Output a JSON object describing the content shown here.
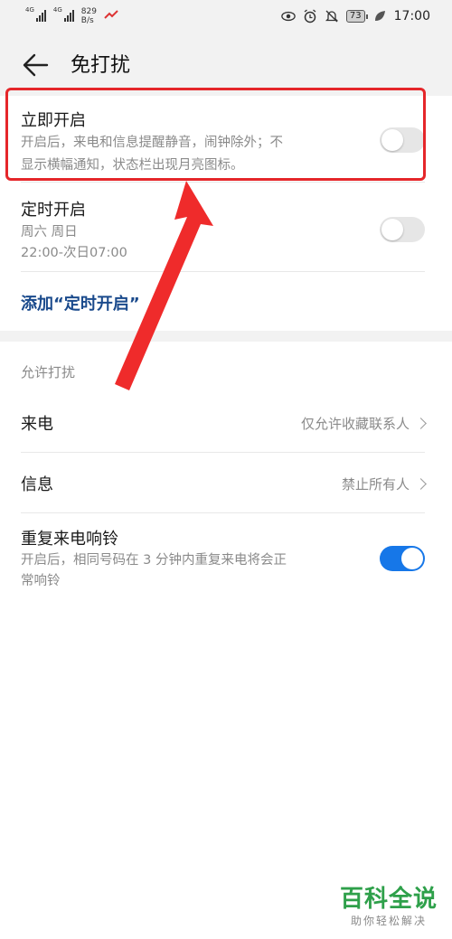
{
  "status_bar": {
    "signal1_type": "4G",
    "signal2_type": "4G",
    "net_speed_value": "829",
    "net_speed_unit": "B/s",
    "battery": "73",
    "time": "17:00",
    "icons": [
      "eye-icon",
      "alarm-icon",
      "bell-off-icon",
      "battery-icon",
      "leaf-icon"
    ]
  },
  "header": {
    "title": "免打扰"
  },
  "immediate": {
    "title": "立即开启",
    "desc_line1": "开启后，来电和信息提醒静音，闹钟除外；不",
    "desc_line2": "显示横幅通知，状态栏出现月亮图标。",
    "enabled": false
  },
  "scheduled": {
    "title": "定时开启",
    "days": "周六 周日",
    "time_range": "22:00-次日07:00",
    "enabled": false
  },
  "add_schedule": {
    "label": "添加“定时开启”"
  },
  "allow_section": {
    "header": "允许打扰"
  },
  "calls": {
    "label": "来电",
    "value": "仅允许收藏联系人"
  },
  "messages": {
    "label": "信息",
    "value": "禁止所有人"
  },
  "repeated_calls": {
    "title": "重复来电响铃",
    "desc_line1": "开启后，相同号码在 3 分钟内重复来电将会正",
    "desc_line2": "常响铃",
    "enabled": true
  },
  "colors": {
    "accent": "#1677e8",
    "link": "#1a4a8c",
    "annotation": "#e5262a",
    "watermark": "#2ea04a"
  },
  "watermark": {
    "main": "百科全说",
    "sub": "助你轻松解决"
  }
}
